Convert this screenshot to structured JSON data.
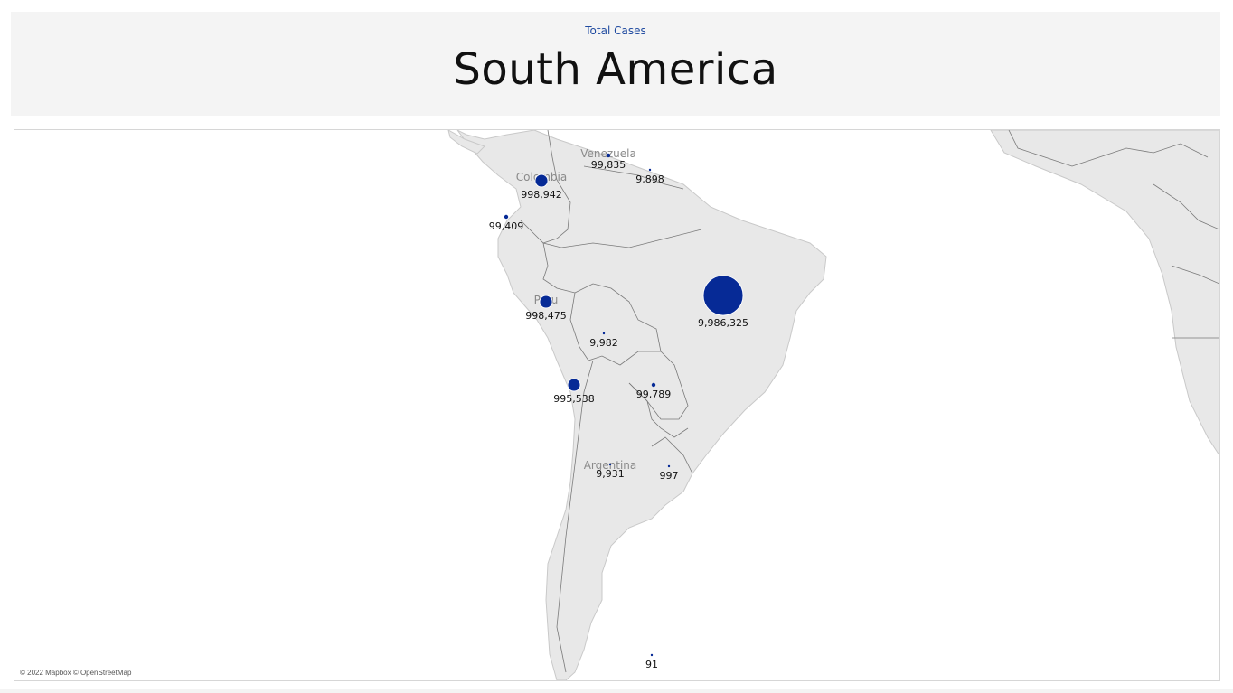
{
  "header": {
    "subtitle": "Total Cases",
    "title": "South America"
  },
  "map": {
    "attribution": "© 2022 Mapbox © OpenStreetMap",
    "country_labels": [
      "Venezuela",
      "Colombia",
      "Peru",
      "Argentina"
    ],
    "marker_color": "#062a96",
    "points": [
      {
        "label": "99,835",
        "value": 99835
      },
      {
        "label": "9,898",
        "value": 9898
      },
      {
        "label": "998,942",
        "value": 998942
      },
      {
        "label": "99,409",
        "value": 99409
      },
      {
        "label": "998,475",
        "value": 998475
      },
      {
        "label": "9,982",
        "value": 9982
      },
      {
        "label": "9,986,325",
        "value": 9986325
      },
      {
        "label": "995,538",
        "value": 995538
      },
      {
        "label": "99,789",
        "value": 99789
      },
      {
        "label": "9,931",
        "value": 9931
      },
      {
        "label": "997",
        "value": 997
      },
      {
        "label": "91",
        "value": 91
      }
    ]
  }
}
